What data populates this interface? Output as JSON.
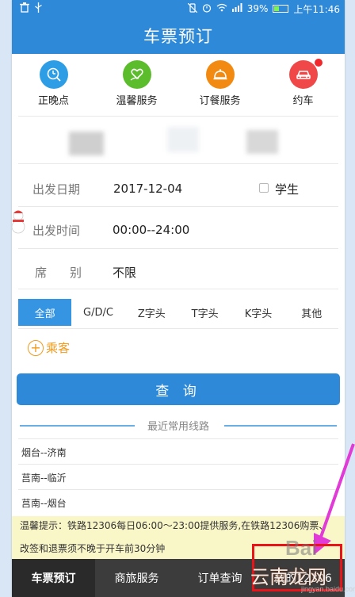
{
  "status_bar": {
    "battery": "39%",
    "time": "上午11:46",
    "battery_level": 0.39
  },
  "title": "车票预订",
  "quick_actions": [
    {
      "label": "正晚点",
      "icon": "clock-search-icon",
      "color": "#2d9ee5"
    },
    {
      "label": "温馨服务",
      "icon": "heart-hand-icon",
      "color": "#5bbd2b"
    },
    {
      "label": "订餐服务",
      "icon": "food-dome-icon",
      "color": "#f28a12"
    },
    {
      "label": "约车",
      "icon": "car-icon",
      "color": "#f04848"
    }
  ],
  "form": {
    "date_label": "出发日期",
    "date_value": "2017-12-04",
    "student_label": "学生",
    "time_label": "出发时间",
    "time_value": "00:00--24:00",
    "seat_label_1": "席",
    "seat_label_2": "别",
    "seat_value": "不限"
  },
  "train_tabs": [
    "全部",
    "G/D/C",
    "Z字头",
    "T字头",
    "K字头",
    "其他"
  ],
  "add_passenger": "乘客",
  "search_button": "查 询",
  "recent_title": "最近常用线路",
  "recent_routes": [
    "烟台--济南",
    "莒南--临沂",
    "莒南--烟台"
  ],
  "tip": {
    "line1": "温馨提示：铁路12306每日06:00～23:00提供服务,在铁路12306购票、",
    "line2": "改签和退票须不晚于开车前30分钟"
  },
  "bottom_nav": [
    "车票预订",
    "商旅服务",
    "订单查询",
    "我的12306"
  ],
  "watermarks": {
    "baidu": "Bai",
    "site": "云南龙网",
    "url": "jingyan.baidu.com"
  },
  "colors": {
    "primary": "#2e8ad8",
    "accent": "#f29b1d",
    "tip_bg": "#f9f6c8",
    "nav_bg": "#3c3c3c"
  }
}
